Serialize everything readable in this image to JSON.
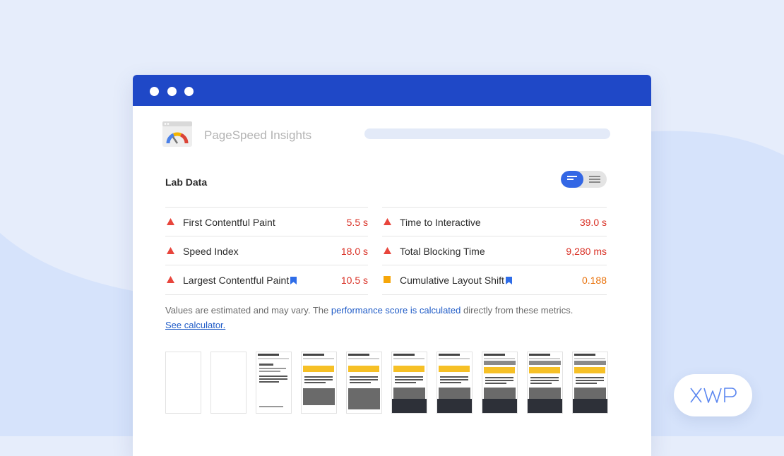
{
  "app": {
    "title": "PageSpeed Insights"
  },
  "lab": {
    "title": "Lab Data"
  },
  "metrics": [
    {
      "label": "First Contentful Paint",
      "value": "5.5 s",
      "status": "fail"
    },
    {
      "label": "Time to Interactive",
      "value": "39.0 s",
      "status": "fail"
    },
    {
      "label": "Speed Index",
      "value": "18.0 s",
      "status": "fail"
    },
    {
      "label": "Total Blocking Time",
      "value": "9,280 ms",
      "status": "fail"
    },
    {
      "label": "Largest Contentful Paint",
      "value": "10.5 s",
      "status": "fail",
      "core_web_vital": true
    },
    {
      "label": "Cumulative Layout Shift",
      "value": "0.188",
      "status": "average",
      "core_web_vital": true
    }
  ],
  "note": {
    "text1": "Values are estimated and may vary. The ",
    "link1": "performance score is calculated",
    "text2": " directly from these metrics. ",
    "link2": "See calculator."
  },
  "colors": {
    "titlebar": "#1f48c7",
    "fail": "#d93025",
    "average": "#e8710a",
    "toggle_active": "#3367e5",
    "link": "#1f5bc7"
  },
  "icons": {
    "fail": "red-triangle-icon",
    "average": "orange-square-icon",
    "core_web_vital": "bookmark-icon"
  },
  "brand": {
    "badge": "XWP"
  }
}
